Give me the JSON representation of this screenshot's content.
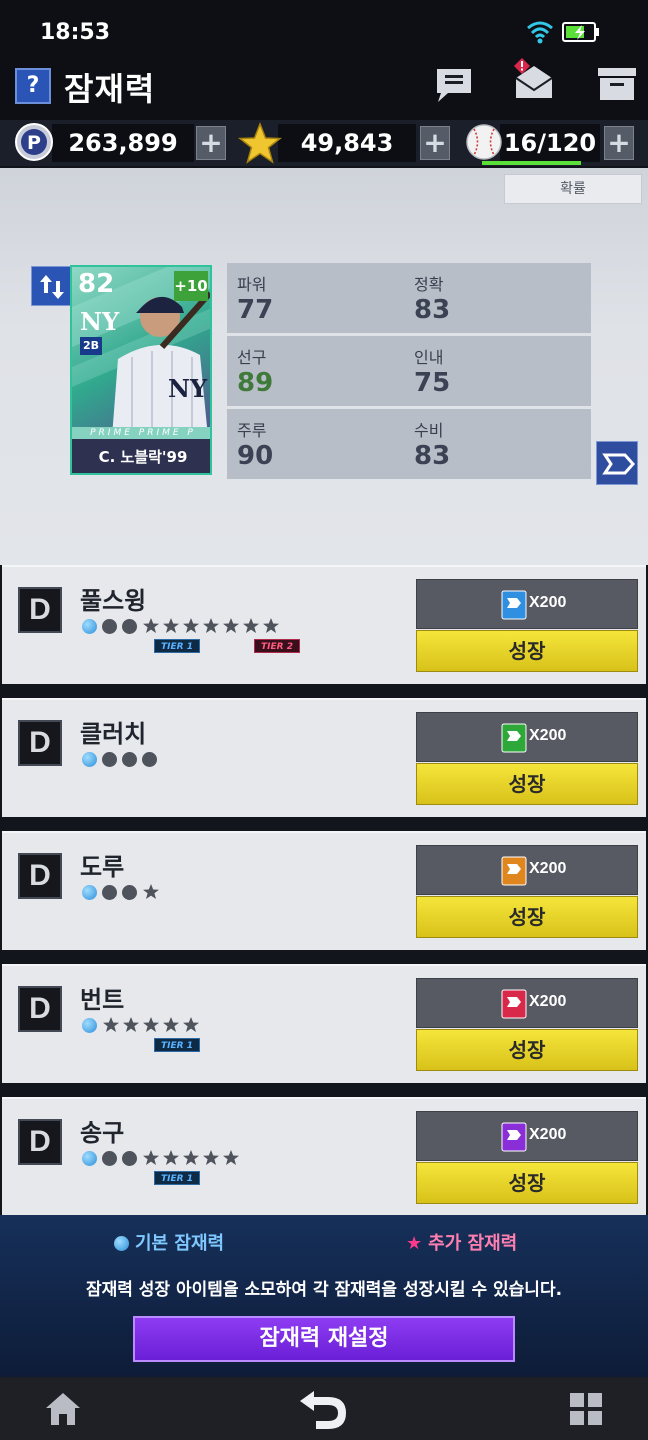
{
  "status": {
    "time": "18:53"
  },
  "header": {
    "help": "?",
    "title": "잠재력"
  },
  "currency": {
    "points": "263,899",
    "stars": "49,843",
    "stamina": "16/120",
    "plus": "+",
    "stamina_fill": 0.95
  },
  "main": {
    "probability_label": "확률",
    "card": {
      "overall": "82",
      "upgrade": "+10",
      "team": "NY",
      "position": "2B",
      "series": "PRIME  PRIME  P",
      "name": "C. 노블락'99"
    },
    "stats": [
      {
        "label": "파워",
        "value": "77"
      },
      {
        "label": "정확",
        "value": "83"
      },
      {
        "label": "선구",
        "value": "89"
      },
      {
        "label": "인내",
        "value": "75"
      },
      {
        "label": "주루",
        "value": "90"
      },
      {
        "label": "수비",
        "value": "83"
      }
    ]
  },
  "potentials": [
    {
      "grade": "D",
      "name": "풀스윙",
      "basic": 3,
      "stars": 7,
      "tier1": "TIER 1",
      "tier2": "TIER 2",
      "cost": "X200",
      "item_color": "#2f8fe0",
      "grow": "성장"
    },
    {
      "grade": "D",
      "name": "클러치",
      "basic": 4,
      "stars": 0,
      "tier1": "",
      "tier2": "",
      "cost": "X200",
      "item_color": "#2fa83a",
      "grow": "성장"
    },
    {
      "grade": "D",
      "name": "도루",
      "basic": 3,
      "stars": 1,
      "tier1": "",
      "tier2": "",
      "cost": "X200",
      "item_color": "#e0861f",
      "grow": "성장"
    },
    {
      "grade": "D",
      "name": "번트",
      "basic": 1,
      "stars": 5,
      "tier1": "TIER 1",
      "tier2": "",
      "cost": "X200",
      "item_color": "#d8294b",
      "grow": "성장"
    },
    {
      "grade": "D",
      "name": "송구",
      "basic": 3,
      "stars": 5,
      "tier1": "TIER 1",
      "tier2": "",
      "cost": "X200",
      "item_color": "#8a2fd8",
      "grow": "성장"
    }
  ],
  "footer": {
    "legend_basic": "기본 잠재력",
    "legend_extra": "추가 잠재력",
    "description": "잠재력 성장 아이템을 소모하여 각 잠재력을 성장시킬 수 있습니다.",
    "reset": "잠재력 재설정"
  },
  "icons": [
    "wifi-icon",
    "battery-icon",
    "chat-icon",
    "mail-icon",
    "storage-icon",
    "p-coin-icon",
    "star-icon",
    "baseball-icon",
    "home-icon",
    "back-icon",
    "grid-icon"
  ]
}
